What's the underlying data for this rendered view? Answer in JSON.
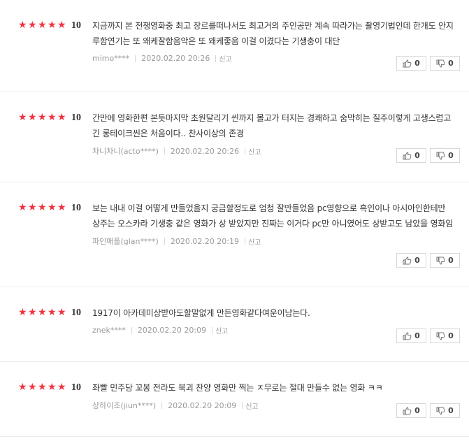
{
  "reviews": [
    {
      "stars": 5,
      "score": "10",
      "text": "지금까지 본 전쟁영화중 최고 장르를떠나서도 최고거의 주인공만 계속 따라가는 촬영기법인데 한개도 안지루함연기는 또 왜케잘함음악은 또 왜케좋음 이걸 이겼다는 기생충이 대단",
      "author": "mimo****",
      "date": "2020.02.20 20:26",
      "report": "신고",
      "likes": "0",
      "dislikes": "0"
    },
    {
      "stars": 5,
      "score": "10",
      "text": "간만에 영화한편 본듯마지막 초원달리기 씬까지 몰고가 터지는 경쾌하고 숨막히는 질주이렇게 고생스럽고 긴 롱테이크씬은 처음이다.. 찬사이상의 존경",
      "author": "차니차니(acto****)",
      "date": "2020.02.20 20:26",
      "report": "신고",
      "likes": "0",
      "dislikes": "0"
    },
    {
      "stars": 5,
      "score": "10",
      "text": "보는 내내 이걸 어떻게 만들었을지 궁금할정도로 엄청 잘만들었음 pc영향으로 흑인이나 아시아인한테만 상주는 오스카라 기생충 같은 영화가 상 받았지만 진짜는 이거다 pc만 아니였어도 상받고도 남았을 영화임",
      "author": "파인애플(glan****)",
      "date": "2020.02.20 20:19",
      "report": "신고",
      "likes": "0",
      "dislikes": "0"
    },
    {
      "stars": 5,
      "score": "10",
      "text": "1917이 아카데미상받아도할말없게 만든영화같다여운이남는다.",
      "author": "znek****",
      "date": "2020.02.20 20:09",
      "report": "신고",
      "likes": "0",
      "dislikes": "0"
    },
    {
      "stars": 5,
      "score": "10",
      "text": "좌빨 민주당 꼬봉 전라도 북괴 찬양 영화만 찍는 ㅈ무로는 절대 만들수 없는 영화 ㅋㅋ",
      "author": "상하이조(jiun****)",
      "date": "2020.02.20 20:09",
      "report": "신고",
      "likes": "0",
      "dislikes": "0"
    }
  ],
  "colors": {
    "star": "#ef3340",
    "border": "#e9e9e9"
  },
  "icons": {
    "star": "star-icon",
    "like": "thumbs-up-icon",
    "dislike": "thumbs-down-icon"
  }
}
